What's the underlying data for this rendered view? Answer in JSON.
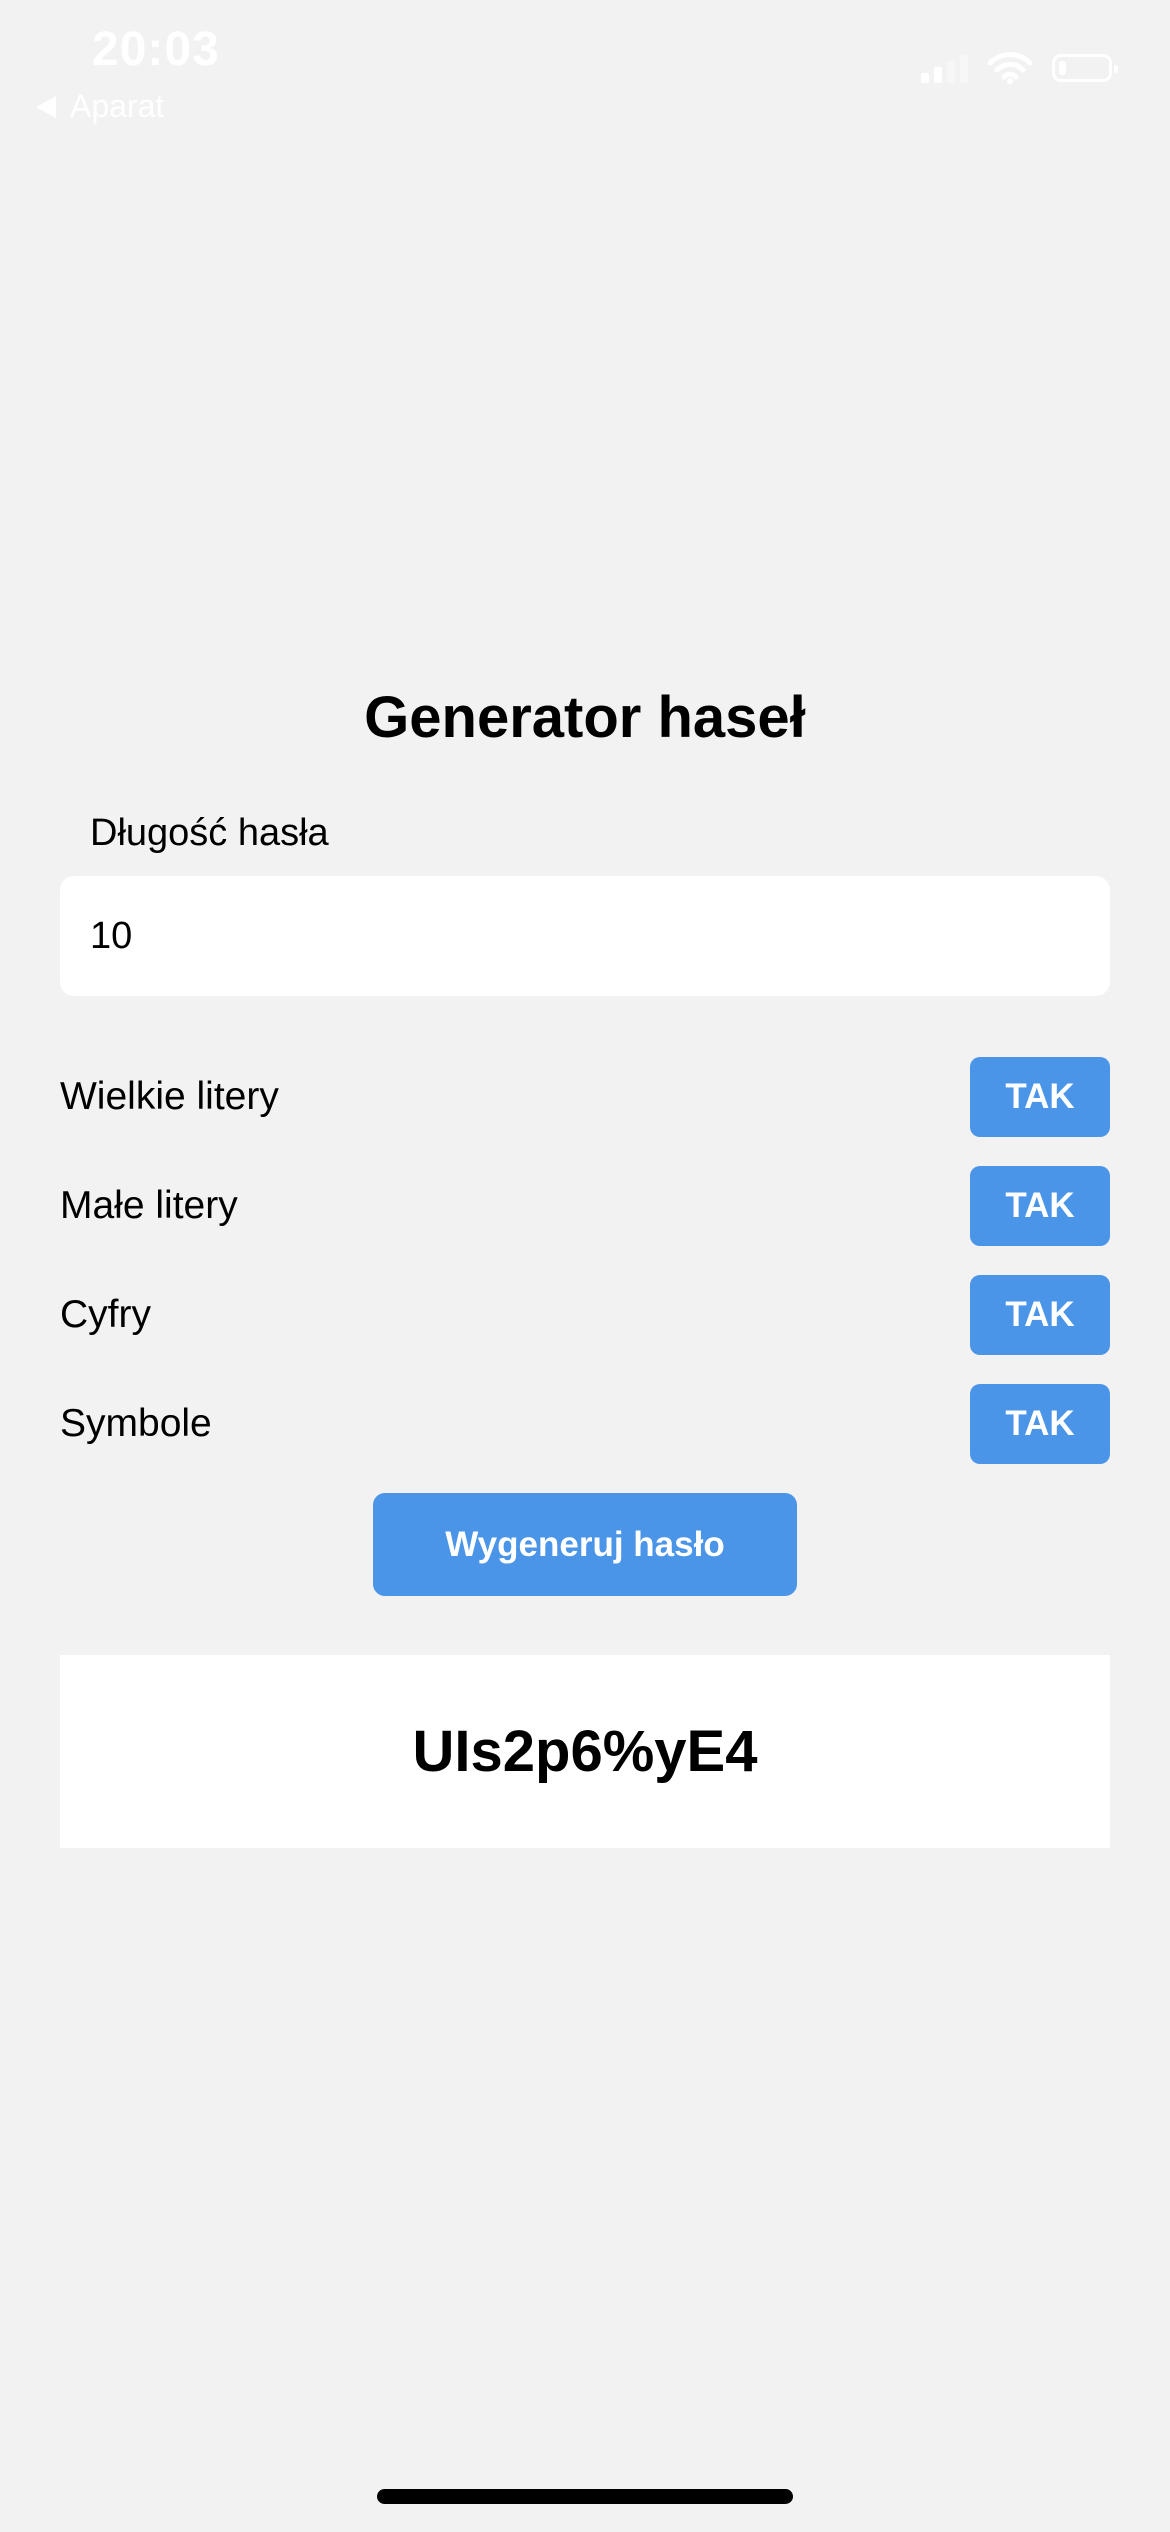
{
  "status_bar": {
    "time": "20:03",
    "back_label": "Aparat",
    "icons": [
      "signal-icon",
      "wifi-icon",
      "battery-icon"
    ],
    "battery_level": 0.15
  },
  "main": {
    "title": "Generator haseł",
    "length_label": "Długość hasła",
    "length_value": "10",
    "options": [
      {
        "label": "Wielkie litery",
        "button": "TAK"
      },
      {
        "label": "Małe litery",
        "button": "TAK"
      },
      {
        "label": "Cyfry",
        "button": "TAK"
      },
      {
        "label": "Symbole",
        "button": "TAK"
      }
    ],
    "generate_label": "Wygeneruj hasło",
    "result": "UIs2p6%yE4"
  },
  "colors": {
    "background": "#f2f2f2",
    "accent": "#4a95e8",
    "surface": "#ffffff"
  }
}
